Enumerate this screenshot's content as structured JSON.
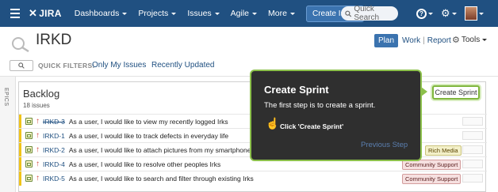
{
  "topbar": {
    "logo": "JIRA",
    "nav": [
      "Dashboards",
      "Projects",
      "Issues",
      "Agile",
      "More"
    ],
    "create_issue": "Create Issue",
    "search_placeholder": "Quick Search",
    "help_glyph": "?"
  },
  "project": {
    "title": "IRKD",
    "view_plan": "Plan",
    "view_work": "Work",
    "view_report": "Report",
    "separator": "|",
    "tools": "Tools"
  },
  "quick_filters": {
    "label": "QUICK FILTERS:",
    "filters": [
      "Only My Issues",
      "Recently Updated"
    ]
  },
  "sidebar": {
    "epics_label": "EPICS"
  },
  "backlog": {
    "title": "Backlog",
    "count": "18 issues",
    "create_sprint": "Create Sprint",
    "issues": [
      {
        "key": "IRKD-3",
        "summary": "As a user, I would like to view my recently logged Irks",
        "epic": ""
      },
      {
        "key": "IRKD-1",
        "summary": "As a user, I would like to track defects in everyday life",
        "epic": ""
      },
      {
        "key": "IRKD-2",
        "summary": "As a user, I would like to attach pictures from my smartphone",
        "epic": "Rich Media"
      },
      {
        "key": "IRKD-4",
        "summary": "As a user, I would like to resolve other peoples Irks",
        "epic": "Community Support"
      },
      {
        "key": "IRKD-5",
        "summary": "As a user, I would like to search and filter through existing Irks",
        "epic": "Community Support"
      }
    ]
  },
  "tooltip": {
    "title": "Create Sprint",
    "body": "The first step is to create a sprint.",
    "hint": "Click 'Create Sprint'",
    "previous": "Previous Step"
  },
  "colors": {
    "nav_bg": "#205081",
    "accent": "#3b73af",
    "tooltip_border": "#8cc04b",
    "priority": "#d04437"
  }
}
